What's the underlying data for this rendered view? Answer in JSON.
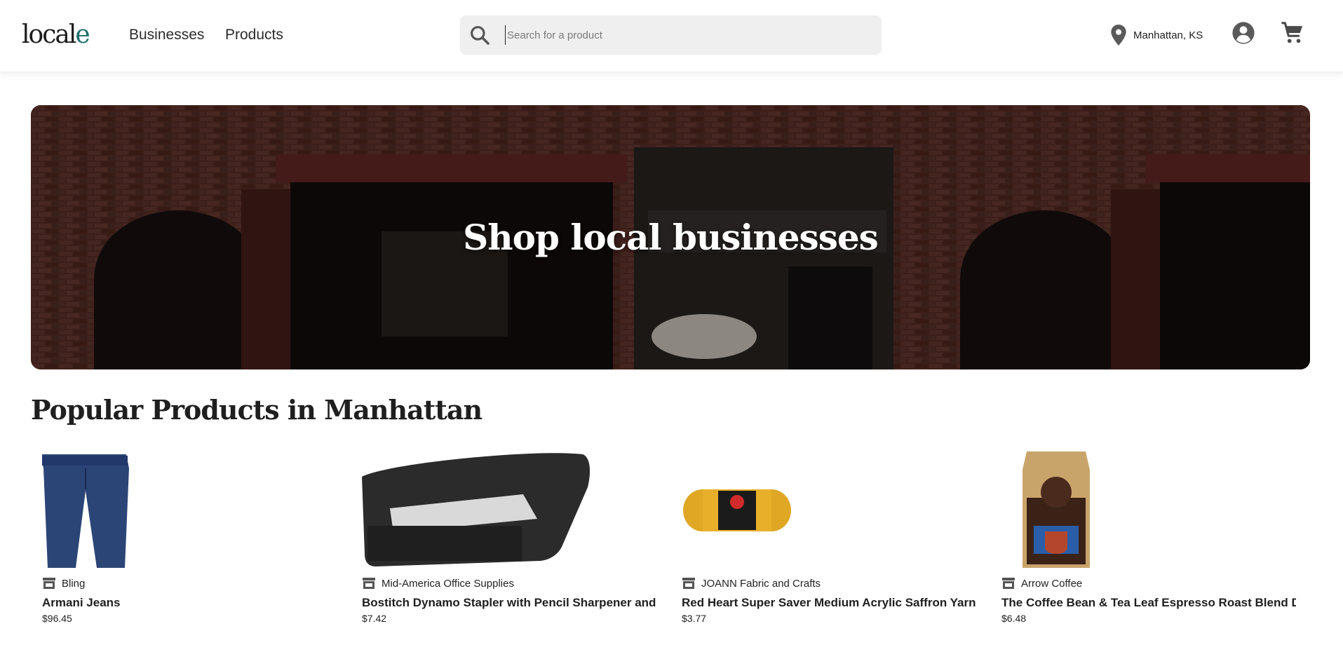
{
  "header": {
    "logo_main": "local",
    "logo_accent_l": "l",
    "logo_accent_e": "e",
    "nav": [
      {
        "label": "Businesses"
      },
      {
        "label": "Products"
      }
    ],
    "search": {
      "placeholder": "Search for a product",
      "value": ""
    },
    "location": "Manhattan, KS",
    "icons": {
      "search": "search-icon",
      "location": "location-pin-icon",
      "account": "account-circle-icon",
      "cart": "shopping-cart-icon"
    }
  },
  "hero": {
    "title": "Shop local businesses"
  },
  "section": {
    "title": "Popular Products in Manhattan"
  },
  "products": [
    {
      "store": "Bling",
      "name": "Armani Jeans",
      "price": "$96.45",
      "image": "jeans"
    },
    {
      "store": "Mid-America Office Supplies",
      "name": "Bostitch Dynamo Stapler with Pencil Sharpener and",
      "price": "$7.42",
      "image": "stapler"
    },
    {
      "store": "JOANN Fabric and Crafts",
      "name": "Red Heart Super Saver Medium Acrylic Saffron Yarn,",
      "price": "$3.77",
      "image": "yarn"
    },
    {
      "store": "Arrow Coffee",
      "name": "The Coffee Bean & Tea Leaf Espresso Roast Blend Da",
      "price": "$6.48",
      "image": "coffee-bag"
    }
  ],
  "colors": {
    "accent": "#1d6e6b",
    "search_bg": "#efefef",
    "text": "#1f1f1f"
  }
}
